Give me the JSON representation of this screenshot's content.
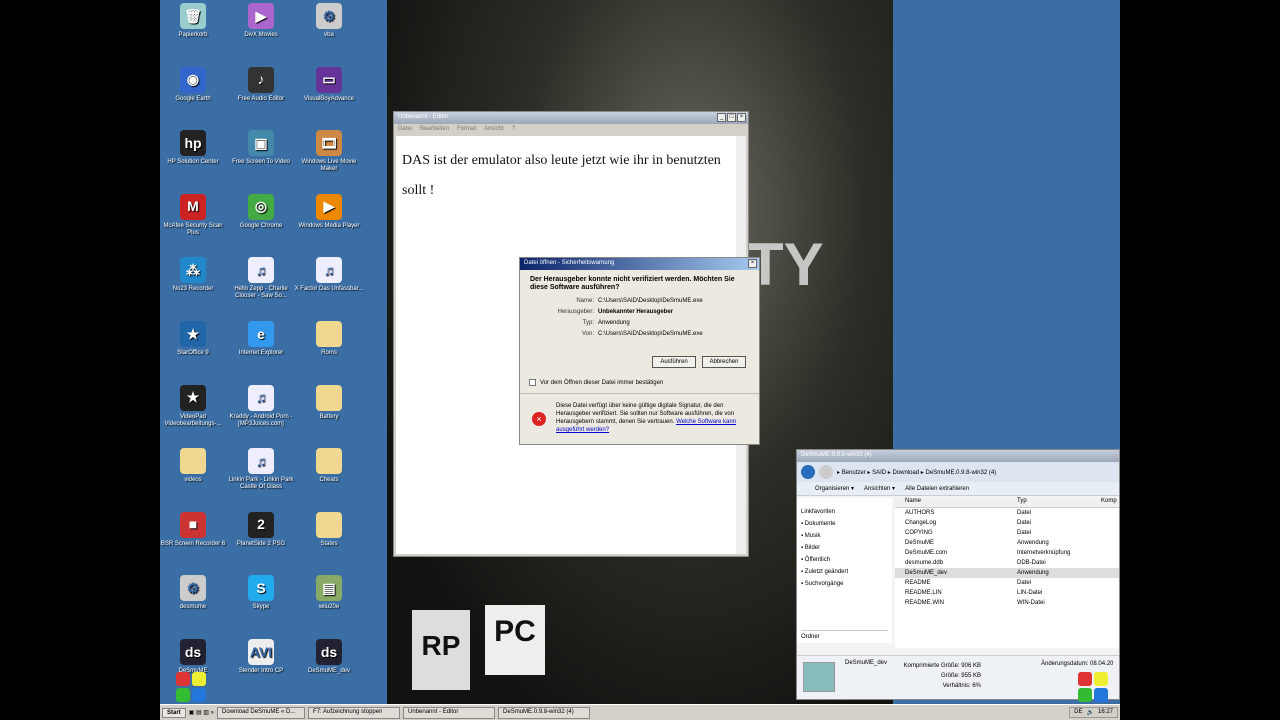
{
  "desktop_icons": [
    {
      "label": "Papierkorb",
      "icon": "recycle-bin-icon",
      "glyph": "🗑",
      "color": "#9cc"
    },
    {
      "label": "DivX Movies",
      "icon": "divx-icon",
      "glyph": "▶",
      "color": "#a6c"
    },
    {
      "label": "vba",
      "icon": "settings-file-icon",
      "glyph": "⚙",
      "color": "#ccc"
    },
    {
      "label": "Google Earth",
      "icon": "google-earth-icon",
      "glyph": "◉",
      "color": "#36c"
    },
    {
      "label": "Free Audio Editor",
      "icon": "audio-editor-icon",
      "glyph": "♪",
      "color": "#333"
    },
    {
      "label": "VisualBoyAdvance",
      "icon": "gameboy-icon",
      "glyph": "▭",
      "color": "#639"
    },
    {
      "label": "HP Solution Center",
      "icon": "hp-icon",
      "glyph": "hp",
      "color": "#222"
    },
    {
      "label": "Free Screen To Video",
      "icon": "screen-video-icon",
      "glyph": "▣",
      "color": "#48a"
    },
    {
      "label": "Windows Live Movie Maker",
      "icon": "movie-maker-icon",
      "glyph": "🎞",
      "color": "#c84"
    },
    {
      "label": "McAfee Security Scan Plus",
      "icon": "mcafee-icon",
      "glyph": "M",
      "color": "#c22"
    },
    {
      "label": "Google Chrome",
      "icon": "chrome-icon",
      "glyph": "◎",
      "color": "#4a4"
    },
    {
      "label": "Windows Media Player",
      "icon": "media-player-icon",
      "glyph": "▶",
      "color": "#e80"
    },
    {
      "label": "No23 Recorder",
      "icon": "recorder-icon",
      "glyph": "⁂",
      "color": "#28c"
    },
    {
      "label": "Hello Zepp - Charlie Clouser - Saw So...",
      "icon": "mp3-file-icon",
      "glyph": "♫",
      "color": "#eef"
    },
    {
      "label": "X Factor Das Unfassbar...",
      "icon": "mp3-file-icon",
      "glyph": "♫",
      "color": "#eef"
    },
    {
      "label": "StarOffice 9",
      "icon": "staroffice-icon",
      "glyph": "★",
      "color": "#26a"
    },
    {
      "label": "Internet Explorer",
      "icon": "ie-icon",
      "glyph": "e",
      "color": "#39e"
    },
    {
      "label": "Roms",
      "icon": "folder-icon",
      "glyph": "",
      "color": "#f0d890"
    },
    {
      "label": "VideoPad Videobearbeitungs-...",
      "icon": "videopad-icon",
      "glyph": "★",
      "color": "#222"
    },
    {
      "label": "Kraddy - Android Porn - [MP3Juices.com]",
      "icon": "mp3-file-icon",
      "glyph": "♫",
      "color": "#eef"
    },
    {
      "label": "Battery",
      "icon": "folder-icon",
      "glyph": "",
      "color": "#f0d890"
    },
    {
      "label": "videos",
      "icon": "folder-icon",
      "glyph": "",
      "color": "#f0d890"
    },
    {
      "label": "Linkin Park - Linkin Park Castle Of Glass",
      "icon": "mp3-file-icon",
      "glyph": "♫",
      "color": "#eef"
    },
    {
      "label": "Cheats",
      "icon": "folder-icon",
      "glyph": "",
      "color": "#f0d890"
    },
    {
      "label": "BSR Screen Recorder 6",
      "icon": "bsr-icon",
      "glyph": "■",
      "color": "#c33"
    },
    {
      "label": "PlanetSide 2 PSG",
      "icon": "planetside-icon",
      "glyph": "2",
      "color": "#222"
    },
    {
      "label": "States",
      "icon": "folder-icon",
      "glyph": "",
      "color": "#f0d890"
    },
    {
      "label": "desmume",
      "icon": "settings-file-icon",
      "glyph": "⚙",
      "color": "#ccc"
    },
    {
      "label": "Skype",
      "icon": "skype-icon",
      "glyph": "S",
      "color": "#2ae"
    },
    {
      "label": "wiiu20e",
      "icon": "installer-icon",
      "glyph": "▤",
      "color": "#8a6"
    },
    {
      "label": "DeSmuME",
      "icon": "desmume-icon",
      "glyph": "ds",
      "color": "#223"
    },
    {
      "label": "Slender Intro CP",
      "icon": "avi-file-icon",
      "glyph": "AVI",
      "color": "#eee"
    },
    {
      "label": "DeSmuME_dev",
      "icon": "desmume-icon",
      "glyph": "ds",
      "color": "#223"
    }
  ],
  "wallpaper": {
    "title_fragment": "TY",
    "rating": "RP",
    "platform": "PC"
  },
  "editor": {
    "title": "Unbenannt - Editor",
    "menu": [
      "Datei",
      "Bearbeiten",
      "Format",
      "Ansicht",
      "?"
    ],
    "text": "DAS ist der emulator also leute jetzt wie ihr in benutzten sollt !"
  },
  "dialog": {
    "title": "Datei öffnen - Sicherheitswarnung",
    "question": "Der Herausgeber konnte nicht verifiziert werden. Möchten Sie diese Software ausführen?",
    "fields": [
      {
        "k": "Name:",
        "v": "C:\\Users\\SAID\\Desktop\\DeSmuME.exe"
      },
      {
        "k": "Herausgeber:",
        "v": "Unbekannter Herausgeber"
      },
      {
        "k": "Typ:",
        "v": "Anwendung"
      },
      {
        "k": "Von:",
        "v": "C:\\Users\\SAID\\Desktop\\DeSmuME.exe"
      }
    ],
    "run": "Ausführen",
    "cancel": "Abbrechen",
    "checkbox": "Vor dem Öffnen dieser Datei immer bestätigen",
    "warning": "Diese Datei verfügt über keine gültige digitale Signatur, die den Herausgeber verifiziert. Sie sollten nur Software ausführen, die von Herausgebern stammt, denen Sie vertrauen.",
    "link": "Welche Software kann ausgeführt werden?"
  },
  "explorer": {
    "title": "DeSmuME.0.9.8-win32 (4)",
    "path": [
      "Benutzer",
      "SAID",
      "Download",
      "DeSmuME.0.9.8-win32 (4)"
    ],
    "toolbar": [
      "Organisieren ▾",
      "Ansichten ▾",
      "Alle Dateien extrahieren"
    ],
    "nav_header": "Linkfavoriten",
    "nav": [
      "Dokumente",
      "Musik",
      "Bilder",
      "Öffentlich",
      "Zuletzt geändert",
      "Suchvorgänge"
    ],
    "folders": "Ordner",
    "columns": [
      "Name",
      "Typ",
      "Komp"
    ],
    "files": [
      {
        "name": "AUTHORS",
        "type": "Datei"
      },
      {
        "name": "ChangeLog",
        "type": "Datei"
      },
      {
        "name": "COPYING",
        "type": "Datei"
      },
      {
        "name": "DeSmuME",
        "type": "Anwendung"
      },
      {
        "name": "DeSmuME.com",
        "type": "Internetverknüpfung"
      },
      {
        "name": "desmume.ddb",
        "type": "DDB-Datei"
      },
      {
        "name": "DeSmuME_dev",
        "type": "Anwendung"
      },
      {
        "name": "README",
        "type": "Datei"
      },
      {
        "name": "README.LIN",
        "type": "LIN-Datei"
      },
      {
        "name": "README.WIN",
        "type": "WIN-Datei"
      }
    ],
    "details": {
      "name": "DeSmuME_dev",
      "compressed": "Komprimierte Größe: 906 KB",
      "size": "Größe: 955 KB",
      "ratio": "Verhältnis: 6%",
      "date": "Änderungsdatum: 08.04.20"
    }
  },
  "taskbar": {
    "start": "Start",
    "items": [
      "Download DeSmuME « D...",
      "F7: Aufzeichnung stoppen",
      "Unbenannt - Editor",
      "DeSmuME.0.9.8-win32 (4)"
    ],
    "lang": "DE",
    "clock": "16:27"
  }
}
